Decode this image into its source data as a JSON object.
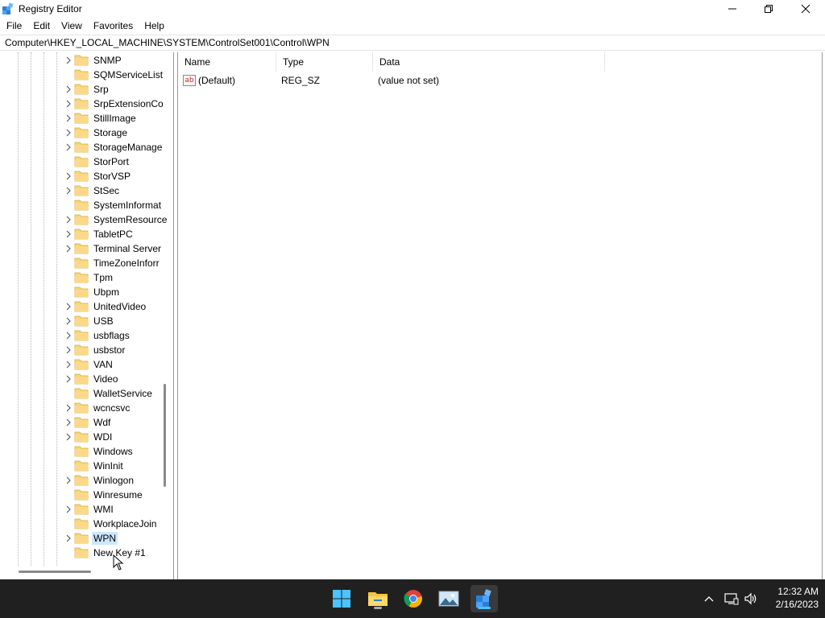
{
  "window": {
    "title": "Registry Editor",
    "minimize_label": "Minimize",
    "restore_label": "Restore",
    "close_label": "Close"
  },
  "menu": [
    "File",
    "Edit",
    "View",
    "Favorites",
    "Help"
  ],
  "address": "Computer\\HKEY_LOCAL_MACHINE\\SYSTEM\\ControlSet001\\Control\\WPN",
  "tree": {
    "items": [
      {
        "label": "SNMP",
        "expandable": true
      },
      {
        "label": "SQMServiceList",
        "expandable": false
      },
      {
        "label": "Srp",
        "expandable": true
      },
      {
        "label": "SrpExtensionCo",
        "expandable": true
      },
      {
        "label": "StillImage",
        "expandable": true
      },
      {
        "label": "Storage",
        "expandable": true
      },
      {
        "label": "StorageManage",
        "expandable": true
      },
      {
        "label": "StorPort",
        "expandable": false
      },
      {
        "label": "StorVSP",
        "expandable": true
      },
      {
        "label": "StSec",
        "expandable": true
      },
      {
        "label": "SystemInformat",
        "expandable": false
      },
      {
        "label": "SystemResource",
        "expandable": true
      },
      {
        "label": "TabletPC",
        "expandable": true
      },
      {
        "label": "Terminal Server",
        "expandable": true
      },
      {
        "label": "TimeZoneInforr",
        "expandable": false
      },
      {
        "label": "Tpm",
        "expandable": false
      },
      {
        "label": "Ubpm",
        "expandable": false
      },
      {
        "label": "UnitedVideo",
        "expandable": true
      },
      {
        "label": "USB",
        "expandable": true
      },
      {
        "label": "usbflags",
        "expandable": true
      },
      {
        "label": "usbstor",
        "expandable": true
      },
      {
        "label": "VAN",
        "expandable": true
      },
      {
        "label": "Video",
        "expandable": true
      },
      {
        "label": "WalletService",
        "expandable": false
      },
      {
        "label": "wcncsvc",
        "expandable": true
      },
      {
        "label": "Wdf",
        "expandable": true
      },
      {
        "label": "WDI",
        "expandable": true
      },
      {
        "label": "Windows",
        "expandable": false
      },
      {
        "label": "WinInit",
        "expandable": false
      },
      {
        "label": "Winlogon",
        "expandable": true
      },
      {
        "label": "Winresume",
        "expandable": false
      },
      {
        "label": "WMI",
        "expandable": true
      },
      {
        "label": "WorkplaceJoin",
        "expandable": false
      },
      {
        "label": "WPN",
        "expandable": true,
        "selected": true
      },
      {
        "label": "New Key #1",
        "expandable": false
      }
    ]
  },
  "list": {
    "columns": [
      "Name",
      "Type",
      "Data"
    ],
    "rows": [
      {
        "name": "(Default)",
        "type": "REG_SZ",
        "data": "(value not set)",
        "icon": "string-value-icon",
        "icon_text": "ab"
      }
    ]
  },
  "taskbar": {
    "apps": [
      "start-icon",
      "file-explorer-icon",
      "chrome-icon",
      "photos-icon",
      "registry-editor-icon"
    ],
    "time": "12:32 AM",
    "date": "2/16/2023"
  },
  "colors": {
    "selection": "#cce8ff",
    "taskbar_bg": "#202020",
    "folder": "#f8d775",
    "accent": "#4cc2ff"
  }
}
